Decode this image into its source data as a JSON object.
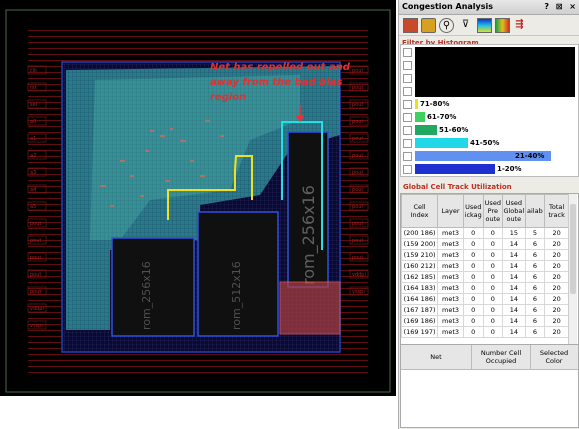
{
  "panel": {
    "title": "Congestion Analysis",
    "controls": "? ⊠ ×",
    "filter_title": "Filter by Histogram",
    "global_title": "Global Cell Track Utilization",
    "histogram": [
      {
        "label": "",
        "fraction": 1.0,
        "color": "#000000"
      },
      {
        "label": "",
        "fraction": 0.0,
        "color": "#000000"
      },
      {
        "label": "",
        "fraction": 0.0,
        "color": "#000000"
      },
      {
        "label": "",
        "fraction": 0.0,
        "color": "#000000"
      },
      {
        "label": "71-80%",
        "fraction": 0.02,
        "color": "#e8e020"
      },
      {
        "label": "61-70%",
        "fraction": 0.06,
        "color": "#40d060"
      },
      {
        "label": "51-60%",
        "fraction": 0.14,
        "color": "#20a860"
      },
      {
        "label": "41-50%",
        "fraction": 0.33,
        "color": "#20d8e8"
      },
      {
        "label": "21-40%",
        "fraction": 0.85,
        "color": "#6090f0"
      },
      {
        "label": "1-20%",
        "fraction": 0.5,
        "color": "#2030d0"
      }
    ],
    "table": {
      "headers": [
        "Cell Index",
        "Layer",
        "Used Blockage",
        "Used Pre Routes",
        "Used Global Routes",
        "Available",
        "Total track"
      ],
      "headers_short": [
        "Cell\nIndex",
        "Layer",
        "Used\nickag",
        "Used\nPre\noute",
        "Used\nGlobal\noute",
        "ailab",
        "Total\ntrack"
      ],
      "rows": [
        [
          "(200 186)",
          "met3",
          "0",
          "0",
          "15",
          "5",
          "20"
        ],
        [
          "(159 200)",
          "met3",
          "0",
          "0",
          "14",
          "6",
          "20"
        ],
        [
          "(159 210)",
          "met3",
          "0",
          "0",
          "14",
          "6",
          "20"
        ],
        [
          "(160 212)",
          "met3",
          "0",
          "0",
          "14",
          "6",
          "20"
        ],
        [
          "(162 185)",
          "met3",
          "0",
          "0",
          "14",
          "6",
          "20"
        ],
        [
          "(164 183)",
          "met3",
          "0",
          "0",
          "14",
          "6",
          "20"
        ],
        [
          "(164 186)",
          "met3",
          "0",
          "0",
          "14",
          "6",
          "20"
        ],
        [
          "(167 187)",
          "met3",
          "0",
          "0",
          "14",
          "6",
          "20"
        ],
        [
          "(169 186)",
          "met3",
          "0",
          "0",
          "14",
          "6",
          "20"
        ],
        [
          "(169 197)",
          "met3",
          "0",
          "0",
          "14",
          "6",
          "20"
        ]
      ]
    },
    "net_headers": [
      "Net",
      "Number Cell Occupied",
      "Selected Color"
    ]
  },
  "layout": {
    "annotation": "Net has repelled out and away from the bad bias region",
    "macro_labels": [
      "rom_256x16",
      "rom_512x16",
      "rom_256x16"
    ],
    "pin_labels_left": [
      "clk",
      "rst",
      "sel",
      "a0",
      "a1",
      "a2",
      "a3",
      "a4",
      "a5",
      "pout",
      "pout",
      "pout",
      "pout",
      "pout",
      "vddpi",
      "vsspi"
    ],
    "pin_labels_right": [
      "pout",
      "pout",
      "pout",
      "pout",
      "pout",
      "pout",
      "pout",
      "pout",
      "pout",
      "pout",
      "pout",
      "pout",
      "vddpi",
      "vsspi"
    ]
  },
  "colors": {
    "accent": "#c03020",
    "canvas_bg": "#000000",
    "highlight": "#e8e020"
  }
}
